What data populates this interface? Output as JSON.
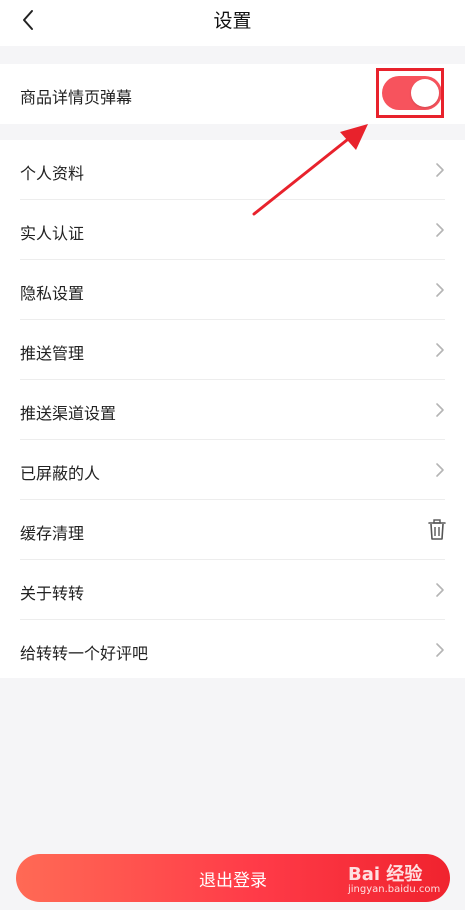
{
  "header": {
    "title": "设置"
  },
  "danmu": {
    "label": "商品详情页弹幕",
    "enabled": true
  },
  "list": [
    {
      "label": "个人资料",
      "icon": "chevron-right-icon"
    },
    {
      "label": "实人认证",
      "icon": "chevron-right-icon"
    },
    {
      "label": "隐私设置",
      "icon": "chevron-right-icon"
    },
    {
      "label": "推送管理",
      "icon": "chevron-right-icon"
    },
    {
      "label": "推送渠道设置",
      "icon": "chevron-right-icon"
    },
    {
      "label": "已屏蔽的人",
      "icon": "chevron-right-icon"
    },
    {
      "label": "缓存清理",
      "icon": "trash-icon"
    },
    {
      "label": "关于转转",
      "icon": "chevron-right-icon"
    },
    {
      "label": "给转转一个好评吧",
      "icon": "chevron-right-icon"
    }
  ],
  "logout": {
    "label": "退出登录"
  },
  "watermark": {
    "brand": "Bai 经验",
    "url": "jingyan.baidu.com"
  },
  "colors": {
    "accent": "#f7535d",
    "highlight": "#e8222c",
    "background": "#f5f5f7"
  }
}
